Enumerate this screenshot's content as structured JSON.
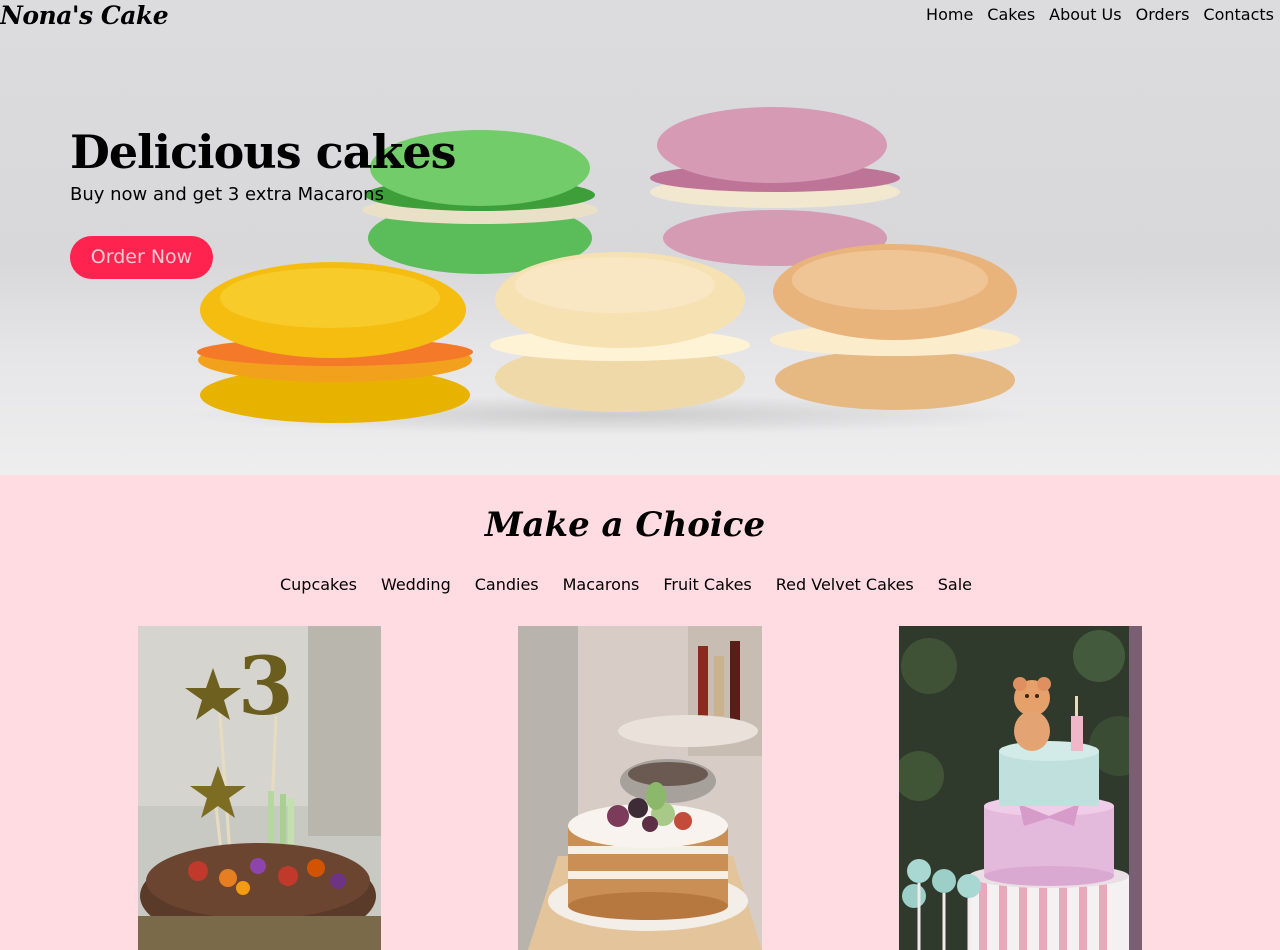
{
  "brand": {
    "logo": "Nona's Cake"
  },
  "nav": {
    "items": [
      "Home",
      "Cakes",
      "About Us",
      "Orders",
      "Contacts"
    ]
  },
  "hero": {
    "title": "Delicious cakes",
    "subtitle": "Buy now and get 3 extra Macarons",
    "cta": "Order Now",
    "cta_color": "#ff2350"
  },
  "choice": {
    "title": "Make a Choice",
    "categories": [
      "Cupcakes",
      "Wedding",
      "Candies",
      "Macarons",
      "Fruit Cakes",
      "Red Velvet Cakes",
      "Sale"
    ]
  },
  "colors": {
    "section_bg": "#ffdbe2",
    "accent": "#ff2350"
  }
}
